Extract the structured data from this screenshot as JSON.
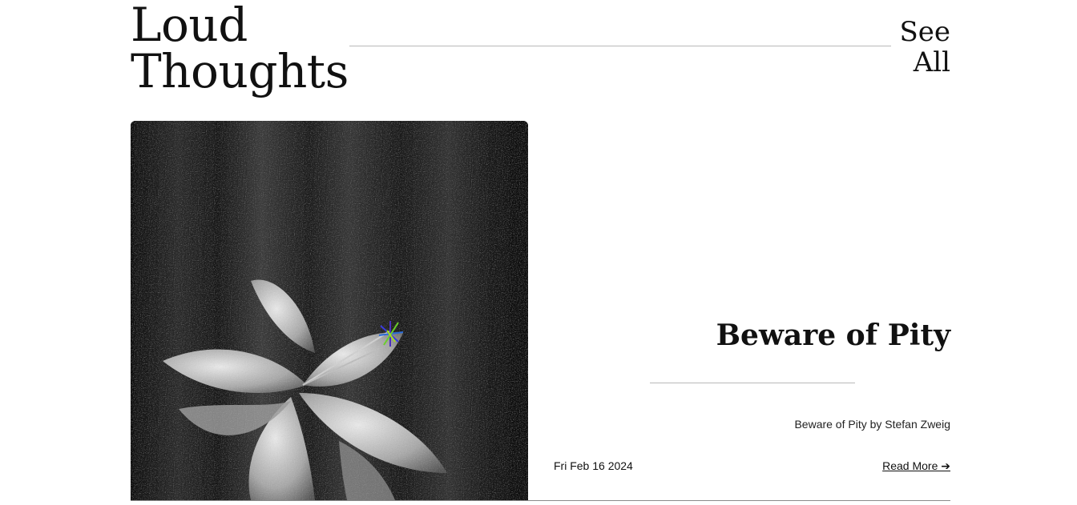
{
  "section": {
    "title_line1": "Loud",
    "title_line2": "Thoughts",
    "see_all_line1": "See",
    "see_all_line2": "All"
  },
  "post": {
    "title": "Beware of Pity",
    "excerpt": "Beware of Pity by Stefan Zweig",
    "date": "Fri Feb 16 2024",
    "read_more": "Read More ➔",
    "image": "lily-flower-grayscale-image"
  },
  "colors": {
    "text": "#111111",
    "rule": "#b8b8b8",
    "background": "#ffffff"
  }
}
